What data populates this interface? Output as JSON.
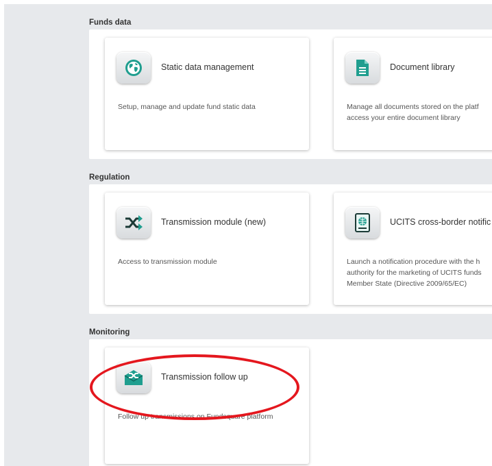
{
  "sections": [
    {
      "title": "Funds data",
      "cards": [
        {
          "title": "Static data management",
          "description": "Setup, manage and update fund static data",
          "icon": "globe-icon"
        },
        {
          "title": "Document library",
          "description": "Manage all documents stored on the platf\naccess your entire document library",
          "icon": "document-icon"
        }
      ]
    },
    {
      "title": "Regulation",
      "cards": [
        {
          "title": "Transmission module (new)",
          "description": "Access to transmission module",
          "icon": "shuffle-icon"
        },
        {
          "title": "UCITS cross-border notific",
          "description": "Launch a notification procedure with the h\nauthority for the marketing of UCITS funds\nMember State (Directive 2009/65/EC)",
          "icon": "passport-icon"
        }
      ]
    },
    {
      "title": "Monitoring",
      "cards": [
        {
          "title": "Transmission follow up",
          "description": "Follow up transmissions on Fundsquare platform",
          "icon": "envelope-shuffle-icon"
        }
      ]
    }
  ],
  "colors": {
    "accent": "#1f9e8f",
    "highlight": "#e4171e",
    "background": "#e7e9ec"
  }
}
